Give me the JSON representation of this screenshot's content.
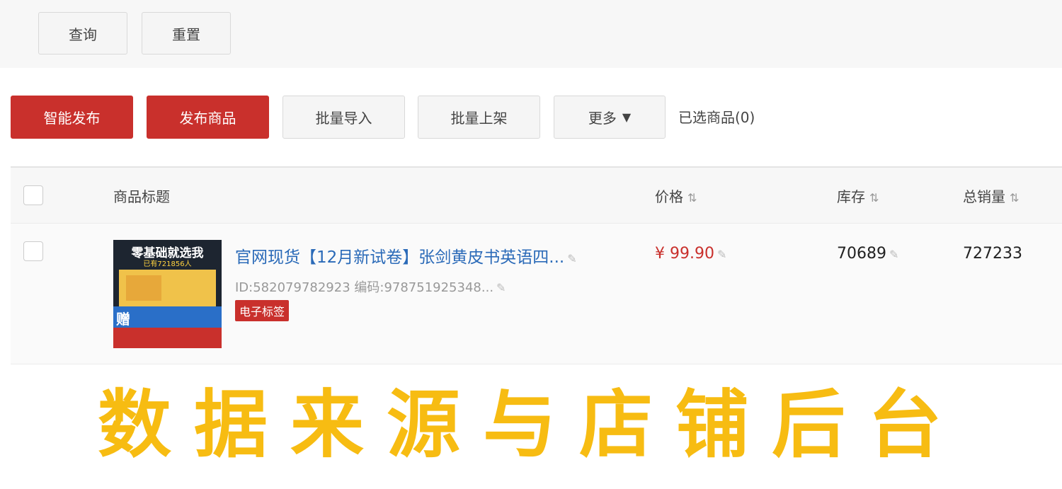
{
  "filter": {
    "search_label": "查询",
    "reset_label": "重置"
  },
  "toolbar": {
    "smart_publish_label": "智能发布",
    "publish_label": "发布商品",
    "batch_import_label": "批量导入",
    "batch_list_label": "批量上架",
    "more_label": "更多",
    "selected_count_text": "已选商品(0)"
  },
  "table": {
    "headers": {
      "title": "商品标题",
      "price": "价格",
      "stock": "库存",
      "sales": "总销量"
    },
    "rows": [
      {
        "thumbnail": {
          "headline": "零基础就选我",
          "sub": "已有721856人",
          "gift": "赠"
        },
        "title": "官网现货【12月新试卷】张剑黄皮书英语四...",
        "meta": "ID:582079782923 编码:978751925348...",
        "tag": "电子标签",
        "price": "¥ 99.90",
        "stock": "70689",
        "sales": "727233"
      }
    ]
  },
  "banner": {
    "text": "数据来源与店铺后台"
  },
  "colors": {
    "accent_red": "#c9302c",
    "link_blue": "#2a6ab8",
    "banner_yellow": "#f7bc12"
  },
  "icons": [
    "caret-down-icon",
    "sort-icon",
    "pencil-icon"
  ]
}
